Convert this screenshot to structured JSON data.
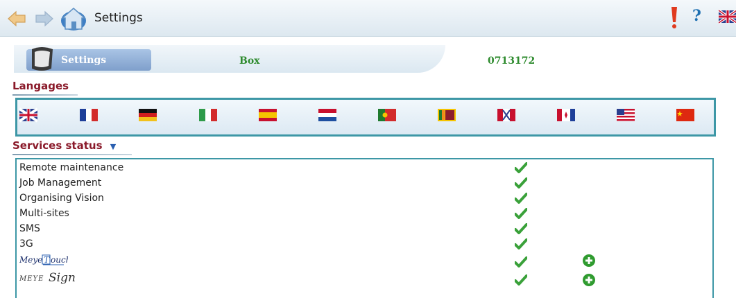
{
  "topbar": {
    "title": "Settings",
    "back_icon": "back-arrow-icon",
    "forward_icon": "forward-arrow-icon",
    "home_icon": "home-icon",
    "alert_icon": "alert-icon",
    "help_label": "?",
    "language_icon": "uk-flag-icon"
  },
  "header": {
    "settings_tab": "Settings",
    "box_label": "Box",
    "box_id": "0713172"
  },
  "languages": {
    "title": "Langages",
    "flags": [
      "uk",
      "france",
      "germany",
      "italy",
      "spain",
      "netherlands",
      "portugal",
      "sri-lanka",
      "quebec-uk",
      "quebec-fr",
      "usa",
      "china"
    ]
  },
  "services": {
    "title": "Services status",
    "toggle_icon": "triangle-down-icon",
    "items": [
      {
        "label": "Remote maintenance",
        "status": "ok"
      },
      {
        "label": "Job Management",
        "status": "ok"
      },
      {
        "label": "Organising Vision",
        "status": "ok"
      },
      {
        "label": "Multi-sites",
        "status": "ok"
      },
      {
        "label": "SMS",
        "status": "ok"
      },
      {
        "label": "3G",
        "status": "ok"
      },
      {
        "label": "MeyeTouch",
        "status": "ok",
        "add": true
      },
      {
        "label": "MEYE Sign",
        "status": "ok",
        "add": true
      }
    ]
  },
  "colors": {
    "accent": "#3d97a6",
    "section_title": "#8a1a2a",
    "box_text": "#2e8b2e",
    "check": "#3aa13a"
  }
}
